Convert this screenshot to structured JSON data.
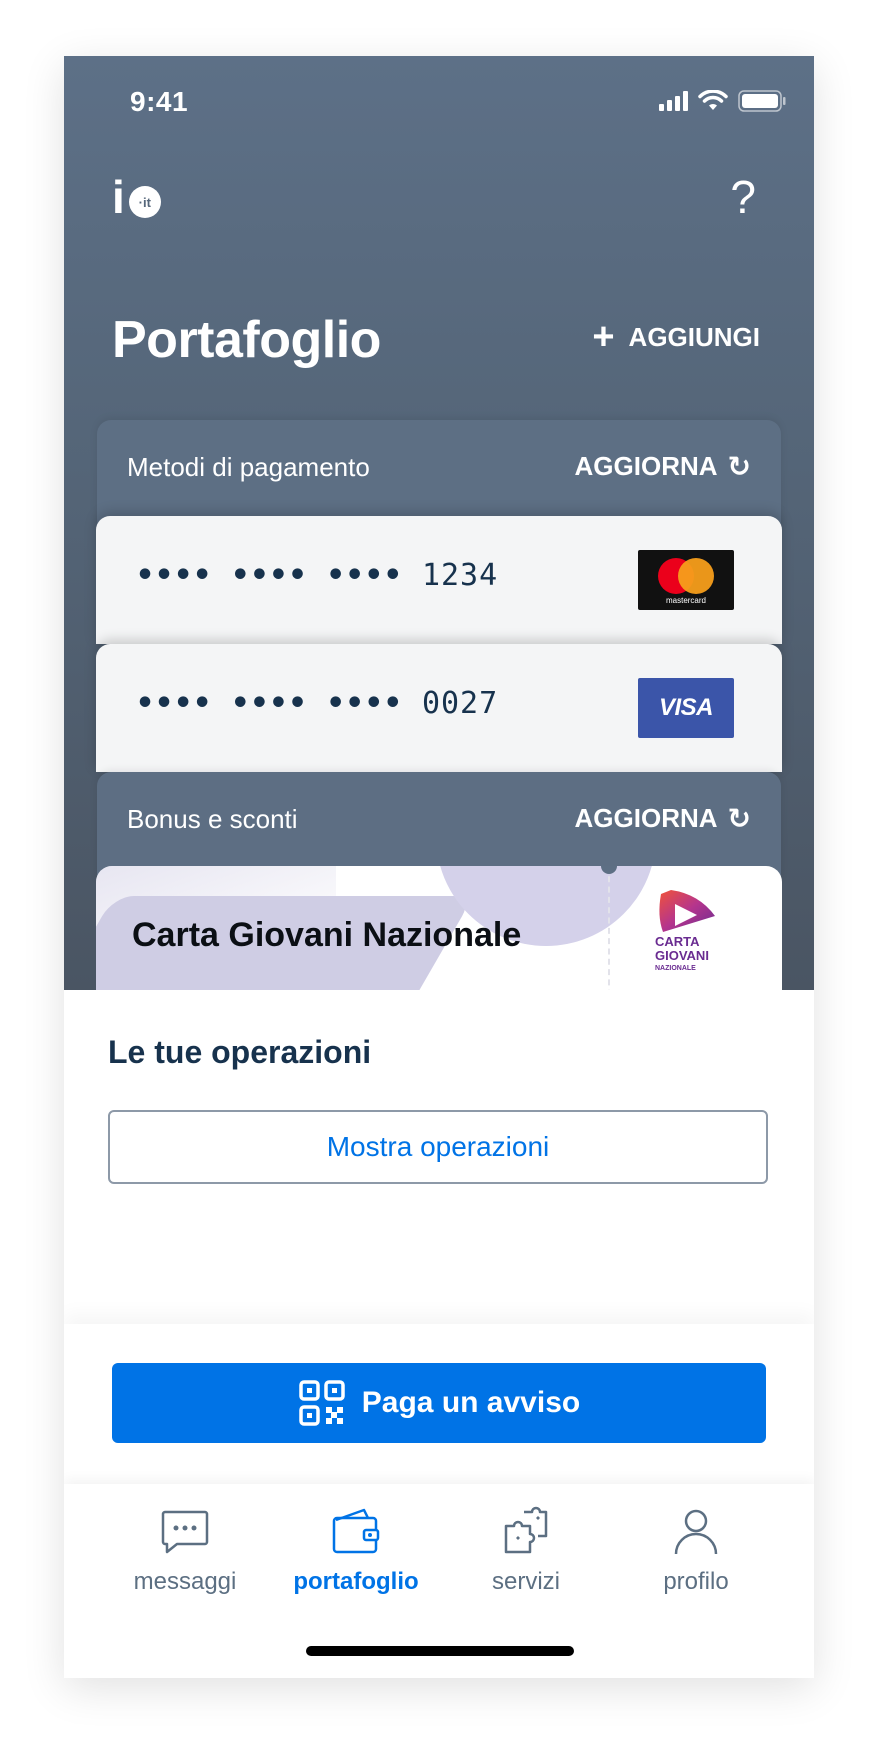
{
  "status_bar": {
    "time": "9:41"
  },
  "header": {
    "logo_letter": "i",
    "logo_badge": "·it",
    "help_symbol": "?",
    "title": "Portafoglio",
    "add_label": "AGGIUNGI",
    "add_symbol": "+"
  },
  "payment_methods": {
    "label": "Metodi di pagamento",
    "refresh_label": "AGGIORNA",
    "refresh_symbol": "↻",
    "cards": [
      {
        "masked": "•••• •••• ••••",
        "last4": "1234",
        "brand": "mastercard"
      },
      {
        "masked": "•••• •••• ••••",
        "last4": "0027",
        "brand": "VISA"
      }
    ]
  },
  "bonus": {
    "label": "Bonus e sconti",
    "refresh_label": "AGGIORNA",
    "refresh_symbol": "↻",
    "card_title": "Carta Giovani Nazionale",
    "logo_lines": [
      "CARTA",
      "GIOVANI",
      "NAZIONALE"
    ]
  },
  "operations": {
    "title": "Le tue operazioni",
    "show_button": "Mostra operazioni"
  },
  "pay_button": {
    "label": "Paga un avviso"
  },
  "tabs": [
    {
      "label": "messaggi",
      "icon": "chat-bubble-icon",
      "active": false
    },
    {
      "label": "portafoglio",
      "icon": "wallet-icon",
      "active": true
    },
    {
      "label": "servizi",
      "icon": "puzzle-icon",
      "active": false
    },
    {
      "label": "profilo",
      "icon": "person-icon",
      "active": false
    }
  ],
  "colors": {
    "primary": "#0073e6",
    "header_bg": "#5d7087",
    "text_dark": "#17324d",
    "tab_inactive": "#5c6f82"
  }
}
